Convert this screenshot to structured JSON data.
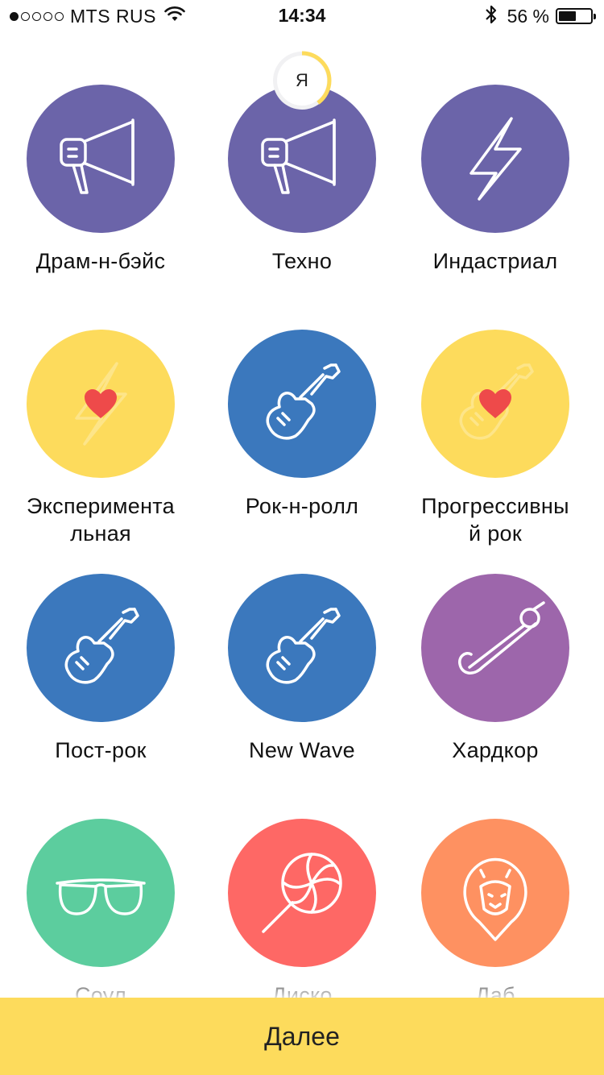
{
  "status_bar": {
    "carrier": "MTS RUS",
    "time": "14:34",
    "battery_percent": "56 %",
    "battery_level": 0.56,
    "signal_filled": 1,
    "signal_total": 5
  },
  "profile": {
    "letter": "Я",
    "progress": 0.4,
    "accent": "#fddb5c"
  },
  "genres": [
    {
      "label": "Драм-н-бэйс",
      "color": "#6b64a9",
      "icon": "megaphone-icon",
      "liked": false
    },
    {
      "label": "Техно",
      "color": "#6b64a9",
      "icon": "megaphone-icon",
      "liked": false
    },
    {
      "label": "Индастриал",
      "color": "#6b64a9",
      "icon": "lightning-icon",
      "liked": false
    },
    {
      "label": "Эксперимента\nльная",
      "color": "#fddb5c",
      "icon": "lightning-icon",
      "liked": true
    },
    {
      "label": "Рок-н-ролл",
      "color": "#3b78bd",
      "icon": "guitar-icon",
      "liked": false
    },
    {
      "label": "Прогрессивны\nй рок",
      "color": "#fddb5c",
      "icon": "guitar-icon",
      "liked": true
    },
    {
      "label": "Пост-рок",
      "color": "#3b78bd",
      "icon": "guitar-icon",
      "liked": false
    },
    {
      "label": "New Wave",
      "color": "#3b78bd",
      "icon": "guitar-icon",
      "liked": false
    },
    {
      "label": "Хардкор",
      "color": "#9d66ab",
      "icon": "safety-pin-icon",
      "liked": false
    },
    {
      "label": "Соул",
      "color": "#5ccd9e",
      "icon": "sunglasses-icon",
      "liked": false
    },
    {
      "label": "Диско",
      "color": "#fe6865",
      "icon": "lollipop-icon",
      "liked": false
    },
    {
      "label": "Даб",
      "color": "#fe9161",
      "icon": "lion-icon",
      "liked": false
    }
  ],
  "heart_color": "#ee4a4a",
  "next_button": {
    "label": "Далее",
    "color": "#fddb5c"
  }
}
